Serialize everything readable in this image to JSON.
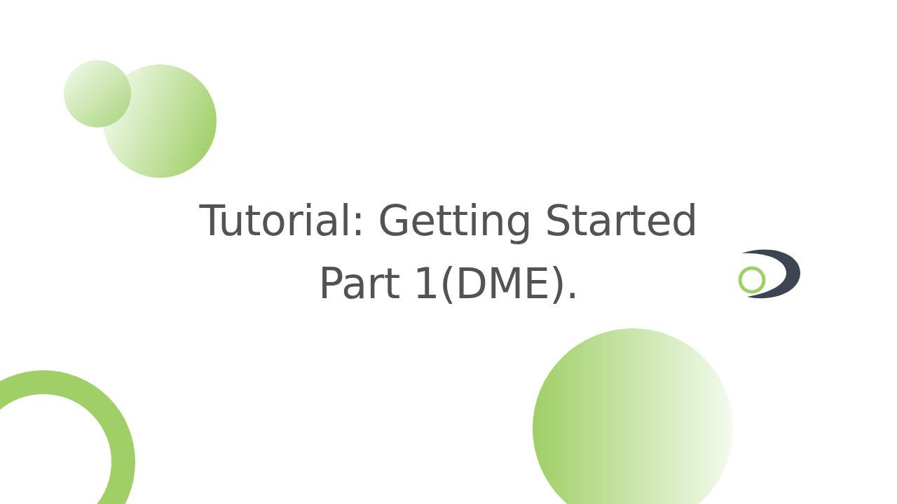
{
  "slide": {
    "title_lines": [
      "Tutorial: Getting Started",
      "Part 1(DME)."
    ]
  }
}
